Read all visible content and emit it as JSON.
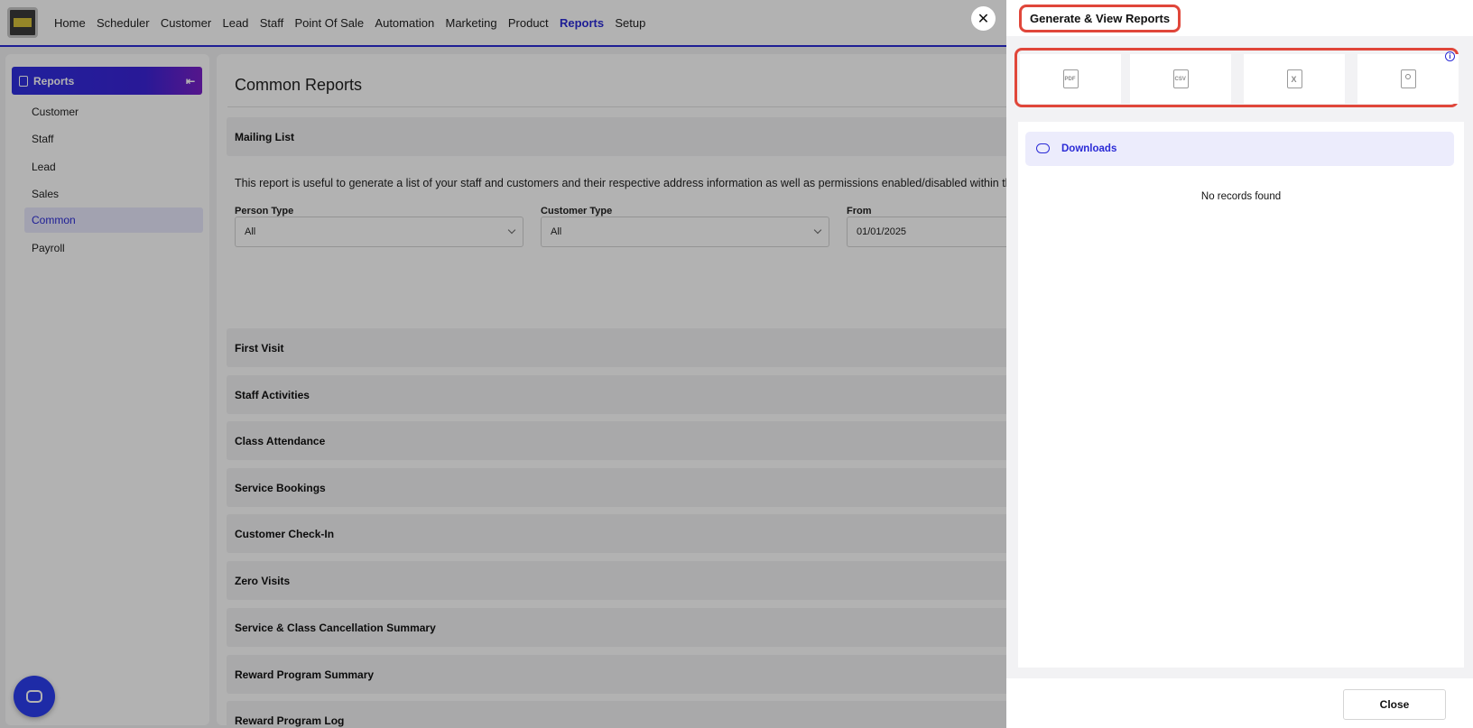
{
  "nav": {
    "items": [
      "Home",
      "Scheduler",
      "Customer",
      "Lead",
      "Staff",
      "Point Of Sale",
      "Automation",
      "Marketing",
      "Product",
      "Reports",
      "Setup"
    ],
    "active": "Reports"
  },
  "sidebar": {
    "title": "Reports",
    "items": [
      {
        "label": "Customer"
      },
      {
        "label": "Staff"
      },
      {
        "label": "Lead"
      },
      {
        "label": "Sales"
      },
      {
        "label": "Common",
        "selected": true
      },
      {
        "label": "Payroll"
      }
    ]
  },
  "main": {
    "title": "Common Reports",
    "mailing_list": "Mailing List",
    "description": "This report is useful to generate a list of your staff and customers and their respective address information as well as permissions enabled/disabled within the",
    "filters": {
      "person_type_label": "Person Type",
      "person_type_value": "All",
      "customer_type_label": "Customer Type",
      "customer_type_value": "All",
      "from_label": "From",
      "from_value": "01/01/2025"
    },
    "sections": [
      "First Visit",
      "Staff Activities",
      "Class Attendance",
      "Service Bookings",
      "Customer Check-In",
      "Zero Visits",
      "Service & Class Cancellation Summary",
      "Reward Program Summary",
      "Reward Program Log"
    ]
  },
  "panel": {
    "title": "Generate & View Reports",
    "formats": [
      {
        "icon": "pdf-file-icon",
        "text": "PDF"
      },
      {
        "icon": "csv-file-icon",
        "text": "CSV"
      },
      {
        "icon": "excel-file-icon",
        "text": "X"
      },
      {
        "icon": "contact-card-icon",
        "text": ""
      }
    ],
    "downloads_label": "Downloads",
    "empty_text": "No records found",
    "close_label": "Close"
  },
  "colors": {
    "accent": "#2b2bd6",
    "highlight": "#e0463a"
  }
}
